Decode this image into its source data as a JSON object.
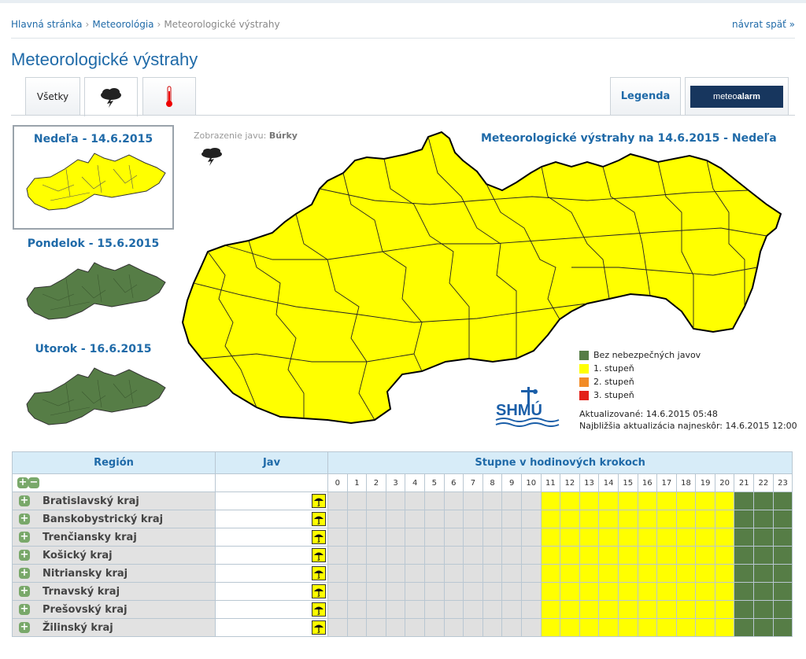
{
  "breadcrumb": {
    "home": "Hlavná stránka",
    "section": "Meteorológia",
    "current": "Meteorologické výstrahy",
    "back": "návrat späť »"
  },
  "page_title": "Meteorologické výstrahy",
  "tabs": {
    "all": "Všetky",
    "legend": "Legenda",
    "meteoalarm_a": "meteo",
    "meteoalarm_b": "alarm"
  },
  "days": [
    {
      "label": "Nedeľa - 14.6.2015",
      "status": "1. stupeň",
      "color": "#ffff00"
    },
    {
      "label": "Pondelok - 15.6.2015",
      "status": "Bez nebezpečných javov",
      "color": "#567d46"
    },
    {
      "label": "Utorok - 16.6.2015",
      "status": "Bez nebezpečných javov",
      "color": "#567d46"
    }
  ],
  "map": {
    "view_label": "Zobrazenie javu:",
    "view_value": "Búrky",
    "title": "Meteorologické výstrahy na 14.6.2015 - Nedeľa",
    "fill_color": "#ffff00"
  },
  "legend": [
    {
      "label": "Bez nebezpečných javov",
      "color": "#567d46"
    },
    {
      "label": "1. stupeň",
      "color": "#ffff00"
    },
    {
      "label": "2. stupeň",
      "color": "#f28c28"
    },
    {
      "label": "3. stupeň",
      "color": "#e32119"
    }
  ],
  "logo_text": "SHMÚ",
  "updated": "Aktualizované: 14.6.2015 05:48",
  "next_update": "Najbližšia aktualizácia najneskôr: 14.6.2015 12:00",
  "table": {
    "headers": {
      "region": "Región",
      "phenomenon": "Jav",
      "steps": "Stupne v hodinových krokoch"
    },
    "hours": [
      "0",
      "1",
      "2",
      "3",
      "4",
      "5",
      "6",
      "7",
      "8",
      "9",
      "10",
      "11",
      "12",
      "13",
      "14",
      "15",
      "16",
      "17",
      "18",
      "19",
      "20",
      "21",
      "22",
      "23"
    ],
    "regions": [
      "Bratislavský kraj",
      "Banskobystrický kraj",
      "Trenčiansky kraj",
      "Košický kraj",
      "Nitriansky kraj",
      "Trnavský kraj",
      "Prešovský kraj",
      "Žilinský kraj"
    ],
    "hour_levels": [
      "none",
      "none",
      "none",
      "none",
      "none",
      "none",
      "none",
      "none",
      "none",
      "none",
      "none",
      "1",
      "1",
      "1",
      "1",
      "1",
      "1",
      "1",
      "1",
      "1",
      "1",
      "0",
      "0",
      "0"
    ],
    "level_colors": {
      "none": "#e0e0e0",
      "1": "#ffff00",
      "0": "#567d46"
    }
  }
}
